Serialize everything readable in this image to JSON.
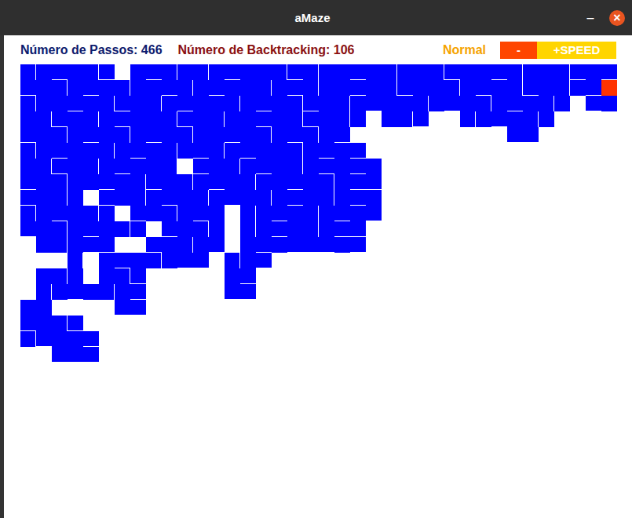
{
  "window": {
    "title": "aMaze",
    "minimize": "–",
    "close": "×"
  },
  "stats": [
    {
      "label": "Número de Passos: 466",
      "color": "#0d1b6e"
    },
    {
      "label": "Número de Backtracking: 106",
      "color": "#8b1010"
    }
  ],
  "speed": {
    "mode": "Normal",
    "buttons": [
      {
        "label": "-",
        "color": "#ff4500"
      },
      {
        "label": "+SPEED",
        "color": "#ffd500"
      }
    ]
  },
  "maze": {
    "columns": 38,
    "rows": [
      "102012.0210102001210020100120021001202",
      "2010201002102001021002012001020120102@",
      "10020120102001020120102001020102010.20",
      "0120102001201002012010.012..102010....",
      "201020102010020102102..........22.....",
      "1020010201021020010202................",
      "0120102001.201020102020...............",
      "20100201201020100201022...............",
      "2010.201020102010201020...............",
      "102010.201020.102010202...............",
      "20102010.2010.10201022................",
      ".01022..20102.02022202................",
      "...1.0201022.102......................",
      ".010.012.....02.......................",
      ".1020102.....22.......................",
      "00....22..............................",
      "2012..................................",
      "12002.................................",
      "..222.................................",
      "......................................",
      "......................................",
      "......................................",
      "......................................",
      "......................................",
      "......................................",
      "......................................",
      "......................................",
      "......................................"
    ]
  }
}
